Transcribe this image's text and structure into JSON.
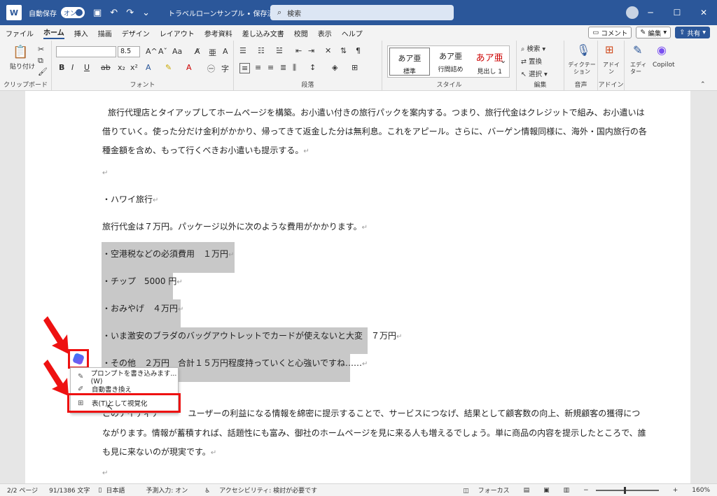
{
  "titlebar": {
    "autosave_label": "自動保存",
    "autosave_state": "オン",
    "document_title": "トラベルローンサンプル • 保存済み ∨",
    "search_placeholder": "検索"
  },
  "tabs": [
    "ファイル",
    "ホーム",
    "挿入",
    "描画",
    "デザイン",
    "レイアウト",
    "参考資料",
    "差し込み文書",
    "校閲",
    "表示",
    "ヘルプ"
  ],
  "active_tab": "ホーム",
  "tab_actions": {
    "comment": "コメント",
    "edit": "編集",
    "share": "共有"
  },
  "ribbon": {
    "clipboard": {
      "paste": "貼り付け",
      "label": "クリップボード"
    },
    "font": {
      "size": "8.5",
      "label": "フォント"
    },
    "paragraph": {
      "label": "段落"
    },
    "styles": {
      "label": "スタイル",
      "items": [
        {
          "preview": "あア亜",
          "name": "標準"
        },
        {
          "preview": "あア亜",
          "name": "行間詰め"
        },
        {
          "preview": "あア亜",
          "name": "見出し 1"
        }
      ]
    },
    "editing": {
      "search": "検索",
      "replace": "置換",
      "select": "選択",
      "label": "編集"
    },
    "voice": {
      "dictate": "ディクテーション",
      "label": "音声"
    },
    "addins": {
      "addins": "アドイン",
      "label": "アドイン"
    },
    "editor": "エディター",
    "copilot": "Copilot"
  },
  "document": {
    "p1_line1": "旅行代理店とタイアップしてホームページを構築。お小遣い付きの旅行パックを案内する。つまり、旅行代金はクレジットで組み、お小遣いは",
    "p1_line2": "借りていく。使った分だけ金利がかかり、帰ってきて返金した分は無利息。これをアピール。さらに、バーゲン情報同様に、海外・国内旅行の各",
    "p1_line3": "種金額を含め、もって行くべきお小遣いも提示する。",
    "hawaii": "・ハワイ旅行",
    "cost_intro": "旅行代金は７万円。パッケージ以外に次のような費用がかかります。",
    "items": [
      "・空港税などの必須費用　１万円",
      "・チップ　5000 円",
      "・おみやげ　４万円",
      "・いま激安のブラダのバッグアウトレットでカードが使えないと大変　７万円",
      "・その他　２万円　合計１５万円程度持っていくと心強いですね……"
    ],
    "p2_line1": "このアイディア",
    "p2_line1b": "ユーザーの利益になる情報を綿密に提示することで、サービスにつなげ、結果として顧客数の向上、新規顧客の獲得につ",
    "p2_line2": "ながります。情報が蓄積すれば、話題性にも富み、御社のホームページを見に来る人も増えるでしょう。単に商品の内容を提示したところで、誰",
    "p2_line3": "も見に来ないのが現実です。"
  },
  "context_menu": {
    "items": [
      {
        "icon": "prompt-icon",
        "label": "プロンプトを書き込みます...(W)"
      },
      {
        "icon": "rewrite-icon",
        "label": "自動書き換え"
      },
      {
        "icon": "table-icon",
        "label": "表(T)として視覚化"
      }
    ]
  },
  "statusbar": {
    "page": "2/2 ページ",
    "words": "91/1386 文字",
    "language": "日本語",
    "prediction": "予測入力: オン",
    "accessibility": "アクセシビリティ: 検討が必要です",
    "focus": "フォーカス",
    "zoom": "160%"
  },
  "colors": {
    "accent": "#2b579a",
    "highlight_box": "#ee1111",
    "selection": "#c8c8c8"
  }
}
